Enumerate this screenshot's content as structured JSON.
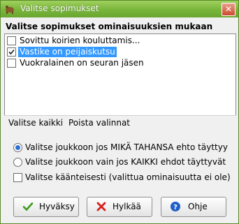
{
  "window": {
    "title": "Valitse sopimukset"
  },
  "group": {
    "title": "Valitse sopimukset ominaisuuksien mukaan"
  },
  "list": {
    "items": [
      {
        "label": "Sovittu koirien kouluttamis...",
        "checked": false,
        "selected": false
      },
      {
        "label": "Vastike on peijaiskutsu",
        "checked": true,
        "selected": true
      },
      {
        "label": "Vuokralainen on seuran jäsen",
        "checked": false,
        "selected": false
      }
    ]
  },
  "toolbar": {
    "select_all": "Valitse kaikki",
    "clear": "Poista valinnat"
  },
  "options": {
    "any": "Valitse joukkoon jos MIKÄ TAHANSA ehto täyttyy",
    "all": "Valitse joukkoon vain jos KAIKKI ehdot täyttyvät",
    "invert": "Valitse käänteisesti (valittua ominaisuutta ei ole)",
    "selected_radio": "any",
    "invert_checked": false
  },
  "buttons": {
    "ok": "Hyväksy",
    "cancel": "Hylkää",
    "help": "Ohje"
  },
  "colors": {
    "title_bar": "#78b53a",
    "selection": "#3399ff",
    "ok_icon": "#3a9a1c",
    "cancel_icon": "#d6211b",
    "help_icon": "#1f5fc8"
  }
}
